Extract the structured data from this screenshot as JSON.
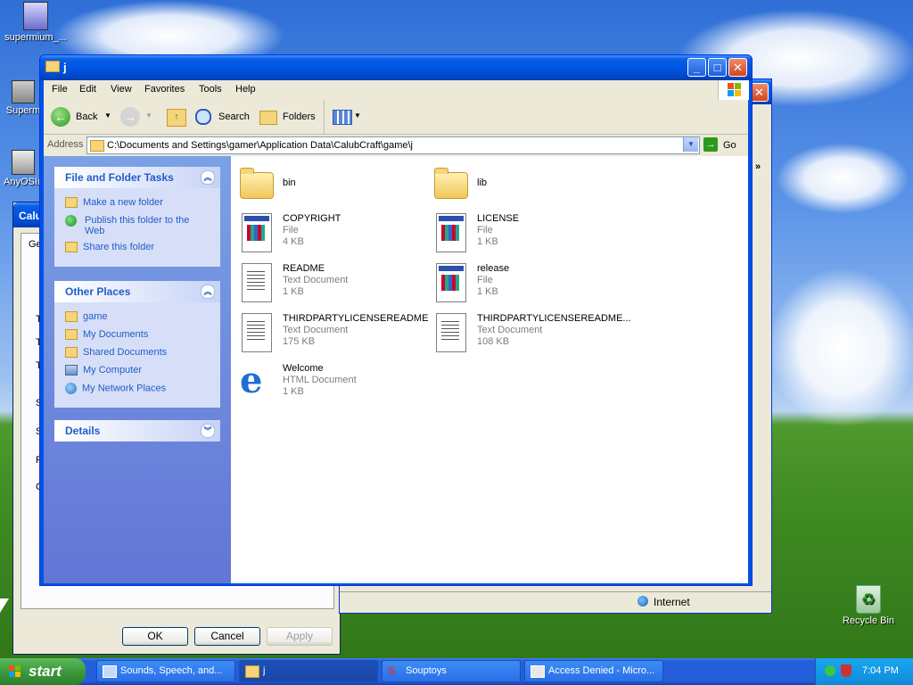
{
  "desktop": {
    "icons": [
      {
        "label": "supermium_..."
      },
      {
        "label": "Superm"
      },
      {
        "label": "AnyOSIn"
      },
      {
        "label": "Recycle Bin"
      }
    ]
  },
  "back_window": {
    "title": "Calu",
    "tab_label": "Ge",
    "side_letters": [
      "T",
      "T",
      "T",
      "S",
      "S",
      "F",
      "C"
    ],
    "ok_label": "OK",
    "cancel_label": "Cancel",
    "apply_label": "Apply"
  },
  "ie_window": {
    "status_zone": "Internet",
    "more_label": "»"
  },
  "explorer": {
    "title": "j",
    "menu": [
      "File",
      "Edit",
      "View",
      "Favorites",
      "Tools",
      "Help"
    ],
    "toolbar": {
      "back": "Back",
      "search": "Search",
      "folders": "Folders"
    },
    "address": {
      "label": "Address",
      "value": "C:\\Documents and Settings\\gamer\\Application Data\\CalubCraft\\game\\j",
      "go": "Go"
    },
    "tasks": {
      "title": "File and Folder Tasks",
      "items": [
        "Make a new folder",
        "Publish this folder to the Web",
        "Share this folder"
      ]
    },
    "other_places": {
      "title": "Other Places",
      "items": [
        "game",
        "My Documents",
        "Shared Documents",
        "My Computer",
        "My Network Places"
      ]
    },
    "details": {
      "title": "Details"
    },
    "files": [
      {
        "name": "bin",
        "type": "",
        "size": "",
        "icon": "folder"
      },
      {
        "name": "lib",
        "type": "",
        "size": "",
        "icon": "folder"
      },
      {
        "name": "COPYRIGHT",
        "type": "File",
        "size": "4 KB",
        "icon": "file"
      },
      {
        "name": "LICENSE",
        "type": "File",
        "size": "1 KB",
        "icon": "file"
      },
      {
        "name": "README",
        "type": "Text Document",
        "size": "1 KB",
        "icon": "text"
      },
      {
        "name": "release",
        "type": "File",
        "size": "1 KB",
        "icon": "file"
      },
      {
        "name": "THIRDPARTYLICENSEREADME",
        "type": "Text Document",
        "size": "175 KB",
        "icon": "text"
      },
      {
        "name": "THIRDPARTYLICENSEREADME...",
        "type": "Text Document",
        "size": "108 KB",
        "icon": "text"
      },
      {
        "name": "Welcome",
        "type": "HTML Document",
        "size": "1 KB",
        "icon": "html"
      }
    ]
  },
  "taskbar": {
    "start": "start",
    "buttons": [
      {
        "label": "Sounds, Speech, and..."
      },
      {
        "label": "j"
      },
      {
        "label": "Souptoys"
      },
      {
        "label": "Access Denied - Micro..."
      }
    ],
    "clock": "7:04 PM"
  },
  "colors": {
    "title_blue": "#0054e3",
    "taskpane_link": "#215dc6",
    "taskbar_blue": "#245edb",
    "start_green": "#3c9a3c"
  }
}
